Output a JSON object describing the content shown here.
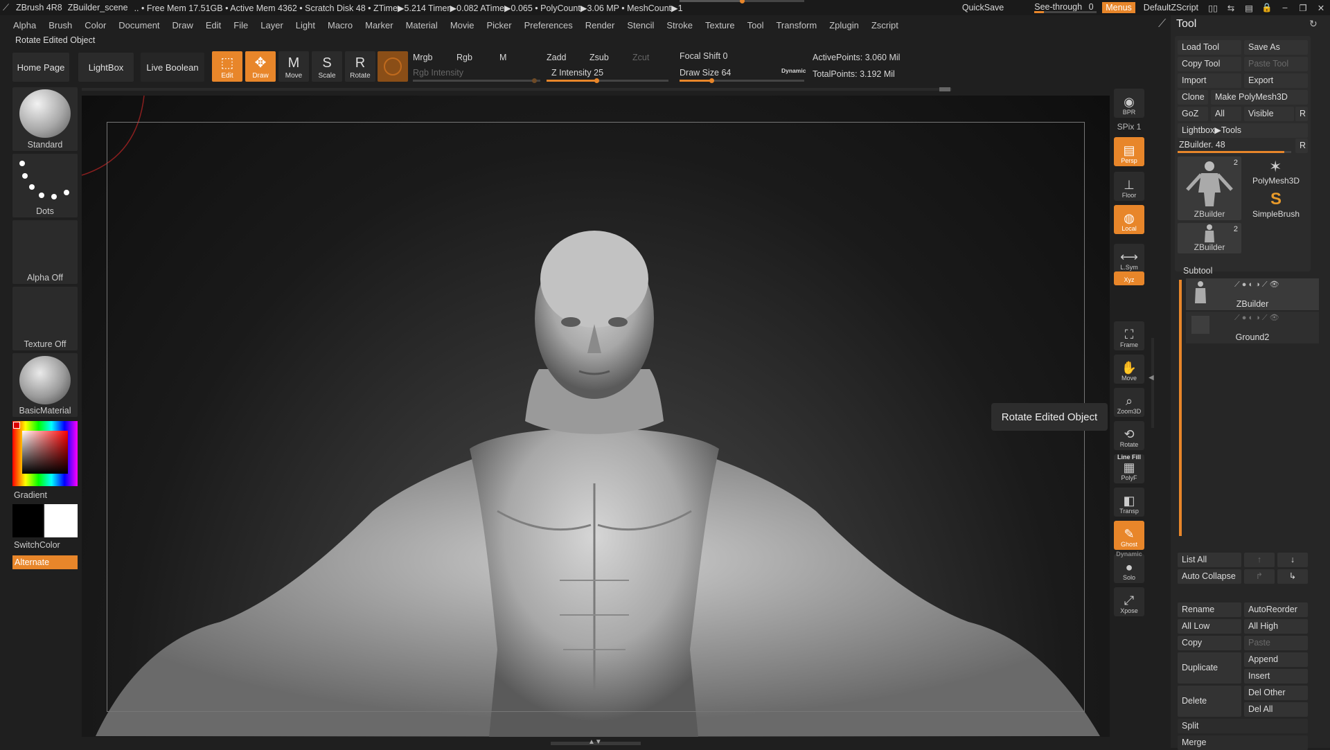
{
  "titlebar": {
    "app": "ZBrush 4R8",
    "scene": "ZBuilder_scene",
    "stats": ".. • Free Mem 17.51GB • Active Mem 4362 • Scratch Disk 48 • ZTime▶5.214 Timer▶0.082 ATime▶0.065 • PolyCount▶3.06 MP • MeshCount▶1",
    "quicksave": "QuickSave",
    "see_through_label": "See-through",
    "see_through_value": "0",
    "see_through_level": 0,
    "menus": "Menus",
    "script": "DefaultZScript"
  },
  "menubar": [
    "Alpha",
    "Brush",
    "Color",
    "Document",
    "Draw",
    "Edit",
    "File",
    "Layer",
    "Light",
    "Macro",
    "Marker",
    "Material",
    "Movie",
    "Picker",
    "Preferences",
    "Render",
    "Stencil",
    "Stroke",
    "Texture",
    "Tool",
    "Transform",
    "Zplugin",
    "Zscript"
  ],
  "status_label": "Rotate Edited Object",
  "shelf": {
    "home": "Home Page",
    "lightbox": "LightBox",
    "live_boolean": "Live Boolean",
    "tools": [
      {
        "label": "Edit",
        "active": true,
        "icon": "edit-icon"
      },
      {
        "label": "Draw",
        "active": true,
        "icon": "draw-icon"
      },
      {
        "label": "Move",
        "active": false,
        "icon": "move-icon"
      },
      {
        "label": "Scale",
        "active": false,
        "icon": "scale-icon"
      },
      {
        "label": "Rotate",
        "active": false,
        "icon": "rotate-icon"
      }
    ],
    "mrgb": "Mrgb",
    "rgb": "Rgb",
    "m": "M",
    "rgb_intensity": "Rgb Intensity",
    "zadd": "Zadd",
    "zsub": "Zsub",
    "zcut": "Zcut",
    "z_intensity_label": "Z Intensity",
    "z_intensity": "25",
    "focal_shift_label": "Focal Shift",
    "focal_shift": "0",
    "draw_size_label": "Draw Size",
    "draw_size": "64",
    "dynamic": "Dynamic",
    "active_points": "ActivePoints: 3.060 Mil",
    "total_points": "TotalPoints: 3.192 Mil"
  },
  "left_shelf": {
    "brush": "Standard",
    "stroke": "Dots",
    "alpha": "Alpha Off",
    "texture": "Texture Off",
    "material": "BasicMaterial",
    "gradient": "Gradient",
    "switch_color": "SwitchColor",
    "alternate": "Alternate",
    "accent": "#e8862a"
  },
  "right_strip": [
    {
      "label": "BPR",
      "icon": "bpr-icon",
      "active": false
    },
    {
      "label": "SPix 1",
      "icon": "spix-icon",
      "active": false
    },
    {
      "label": "Persp",
      "icon": "persp-icon",
      "active": true
    },
    {
      "label": "Floor",
      "icon": "floor-icon",
      "active": false
    },
    {
      "label": "Local",
      "icon": "local-icon",
      "active": true
    },
    {
      "label": "L.Sym",
      "icon": "lsym-icon",
      "active": false
    },
    {
      "label": "Xyz",
      "icon": "xyz-icon",
      "active": true
    },
    {
      "label": "Frame",
      "icon": "frame-icon",
      "active": false
    },
    {
      "label": "Move",
      "icon": "move-view-icon",
      "active": false
    },
    {
      "label": "Zoom3D",
      "icon": "zoom3d-icon",
      "active": false
    },
    {
      "label": "Rotate",
      "icon": "rotate-view-icon",
      "active": false
    },
    {
      "label": "PolyF",
      "icon": "polyf-icon",
      "active": false
    },
    {
      "label": "Transp",
      "icon": "transp-icon",
      "active": false
    },
    {
      "label": "Ghost",
      "icon": "ghost-icon",
      "active": true
    },
    {
      "label": "Solo",
      "icon": "solo-icon",
      "active": false
    },
    {
      "label": "Xpose",
      "icon": "xpose-icon",
      "active": false
    }
  ],
  "strip_extra": {
    "line_fill": "Line Fill",
    "dynamic": "Dynamic"
  },
  "tooltip": "Rotate Edited Object",
  "palette": {
    "title": "Tool",
    "load": "Load Tool",
    "save": "Save As",
    "copy": "Copy Tool",
    "paste": "Paste Tool",
    "import": "Import",
    "export": "Export",
    "clone": "Clone",
    "make": "Make PolyMesh3D",
    "goz": "GoZ",
    "all": "All",
    "visible": "Visible",
    "r": "R",
    "lightbox_tools": "Lightbox▶Tools",
    "zbuilder_slider": "ZBuilder. 48",
    "thumbs": [
      {
        "name": "ZBuilder",
        "count": "2"
      },
      {
        "name": "PolyMesh3D",
        "count": ""
      },
      {
        "name": "SimpleBrush",
        "count": ""
      },
      {
        "name": "ZBuilder",
        "count": "2"
      }
    ],
    "subtool": "Subtool",
    "subtools": [
      "ZBuilder",
      "Ground2"
    ],
    "list_all": "List All",
    "auto_collapse": "Auto Collapse",
    "rename": "Rename",
    "autoreorder": "AutoReorder",
    "all_low": "All Low",
    "all_high": "All High",
    "copy2": "Copy",
    "paste2": "Paste",
    "duplicate": "Duplicate",
    "append": "Append",
    "insert": "Insert",
    "delete": "Delete",
    "del_other": "Del Other",
    "del_all": "Del All",
    "split": "Split",
    "merge": "Merge"
  }
}
